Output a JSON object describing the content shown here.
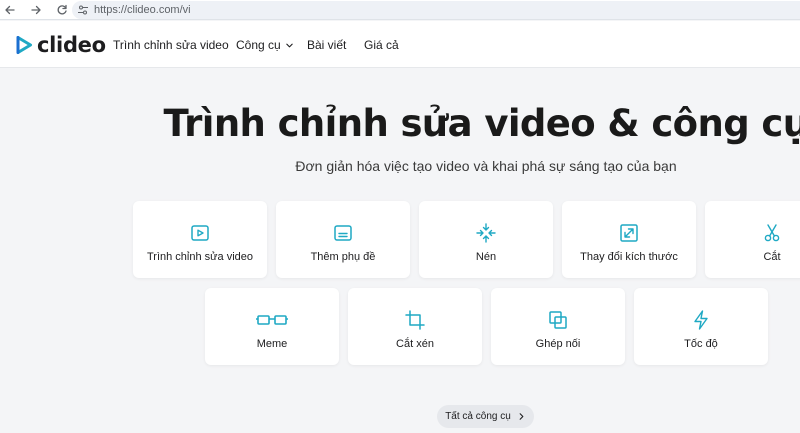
{
  "browser": {
    "url": "https://clideo.com/vi"
  },
  "header": {
    "logo_text": "clideo",
    "nav": [
      {
        "label": "Trình chỉnh sửa video"
      },
      {
        "label": "Công cụ"
      },
      {
        "label": "Bài viết"
      },
      {
        "label": "Giá cả"
      }
    ]
  },
  "hero": {
    "title": "Trình chỉnh sửa video & công cụ",
    "subtitle": "Đơn giản hóa việc tạo video và khai phá sự sáng tạo của bạn"
  },
  "tools_row1": [
    {
      "label": "Trình chỉnh sửa video",
      "icon": "play-icon"
    },
    {
      "label": "Thêm phụ đề",
      "icon": "subtitles-icon"
    },
    {
      "label": "Nén",
      "icon": "compress-icon"
    },
    {
      "label": "Thay đổi kích thước",
      "icon": "resize-icon"
    },
    {
      "label": "Cắt",
      "icon": "scissors-icon"
    }
  ],
  "tools_row2": [
    {
      "label": "Meme",
      "icon": "glasses-icon"
    },
    {
      "label": "Cắt xén",
      "icon": "crop-icon"
    },
    {
      "label": "Ghép nối",
      "icon": "merge-icon"
    },
    {
      "label": "Tốc độ",
      "icon": "lightning-icon"
    }
  ],
  "all_tools_label": "Tất cả công cụ",
  "colors": {
    "accent": "#1fa9c4",
    "background": "#f4f5f7",
    "card": "#ffffff"
  }
}
